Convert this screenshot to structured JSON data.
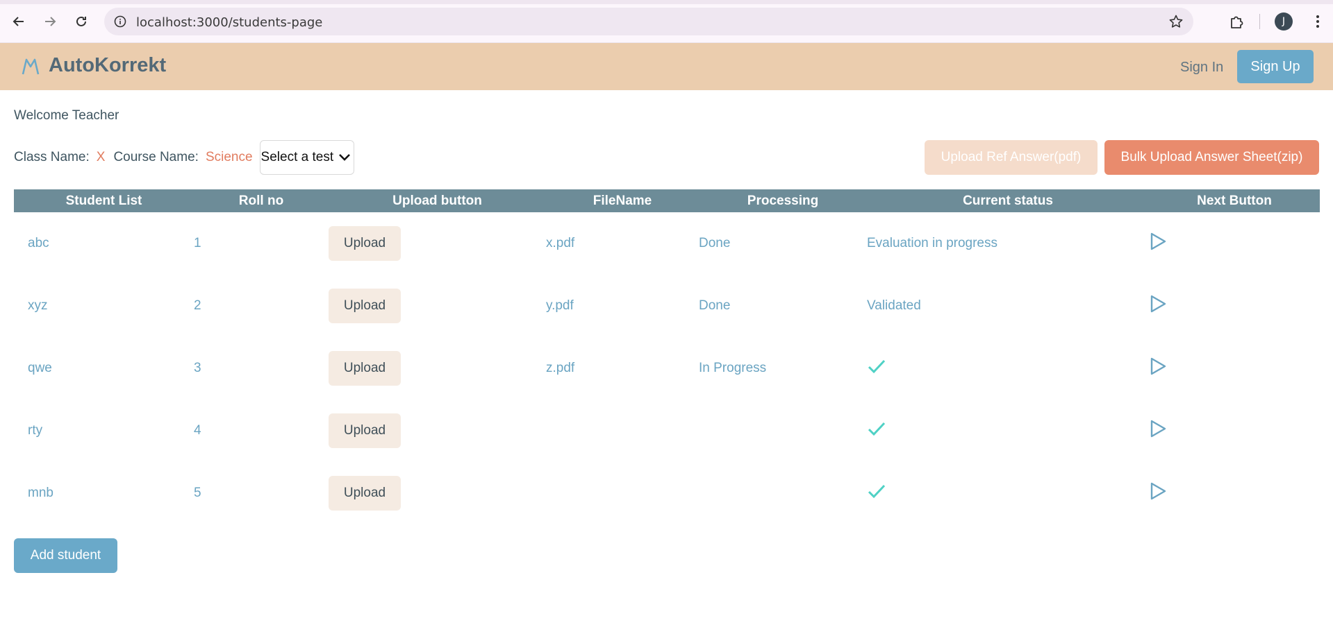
{
  "browser": {
    "url": "localhost:3000/students-page",
    "avatar_letter": "J"
  },
  "header": {
    "brand": "AutoKorrekt",
    "sign_in": "Sign In",
    "sign_up": "Sign Up"
  },
  "main": {
    "welcome": "Welcome Teacher",
    "class_label": "Class Name:",
    "class_value": "X",
    "course_label": "Course Name:",
    "course_value": "Science",
    "test_select": "Select a test",
    "upload_ref_label": "Upload Ref Answer(pdf)",
    "bulk_upload_label": "Bulk Upload Answer Sheet(zip)",
    "add_student_label": "Add student"
  },
  "table": {
    "headers": [
      "Student List",
      "Roll no",
      "Upload button",
      "FileName",
      "Processing",
      "Current status",
      "Next Button"
    ],
    "upload_label": "Upload",
    "rows": [
      {
        "name": "abc",
        "roll": "1",
        "file": "x.pdf",
        "processing": "Done",
        "status": "Evaluation in progress",
        "status_icon": ""
      },
      {
        "name": "xyz",
        "roll": "2",
        "file": "y.pdf",
        "processing": "Done",
        "status": "Validated",
        "status_icon": ""
      },
      {
        "name": "qwe",
        "roll": "3",
        "file": "z.pdf",
        "processing": "In Progress",
        "status": "",
        "status_icon": "check-icon"
      },
      {
        "name": "rty",
        "roll": "4",
        "file": "",
        "processing": "",
        "status": "",
        "status_icon": "check-icon"
      },
      {
        "name": "mnb",
        "roll": "5",
        "file": "",
        "processing": "",
        "status": "",
        "status_icon": "check-icon"
      }
    ]
  },
  "colors": {
    "header_bg": "#ebcdae",
    "accent_blue": "#6aa9c9",
    "accent_orange": "#e98b6d",
    "table_head": "#6d8c98",
    "check": "#4fd1c5"
  }
}
